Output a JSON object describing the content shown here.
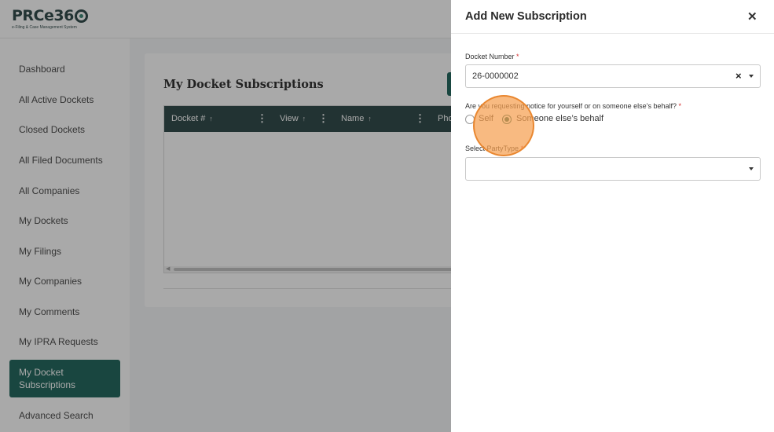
{
  "logo": {
    "text": "PRCe36",
    "subtitle": "e-Filing & Case Management System"
  },
  "sidebar": {
    "items": [
      {
        "label": "Dashboard"
      },
      {
        "label": "All Active Dockets"
      },
      {
        "label": "Closed Dockets"
      },
      {
        "label": "All Filed Documents"
      },
      {
        "label": "All Companies"
      },
      {
        "label": "My Dockets"
      },
      {
        "label": "My Filings"
      },
      {
        "label": "My Companies"
      },
      {
        "label": "My Comments"
      },
      {
        "label": "My IPRA Requests"
      },
      {
        "label": "My Docket Subscriptions",
        "active": true
      },
      {
        "label": "Advanced Search"
      }
    ]
  },
  "main": {
    "title": "My Docket Subscriptions",
    "grid": {
      "columns": [
        "Docket #",
        "View",
        "Name",
        "Pho"
      ]
    }
  },
  "drawer": {
    "title": "Add New Subscription",
    "close_icon": "close-icon",
    "docket_number": {
      "label": "Docket Number",
      "required": "*",
      "value": "26-0000002"
    },
    "notice_question": {
      "label": "Are you requesting notice for yourself or on someone else’s behalf?",
      "required": "*",
      "options": [
        {
          "label": "Self",
          "checked": false
        },
        {
          "label": "Someone else’s behalf",
          "checked": true
        }
      ]
    },
    "party_type": {
      "label": "Select PartyType",
      "required": "*",
      "value": ""
    }
  },
  "colors": {
    "brand": "#0f5a50",
    "grid_header": "#1f3b3b",
    "required": "#d32f2f",
    "click_indicator": "#f5a050"
  }
}
